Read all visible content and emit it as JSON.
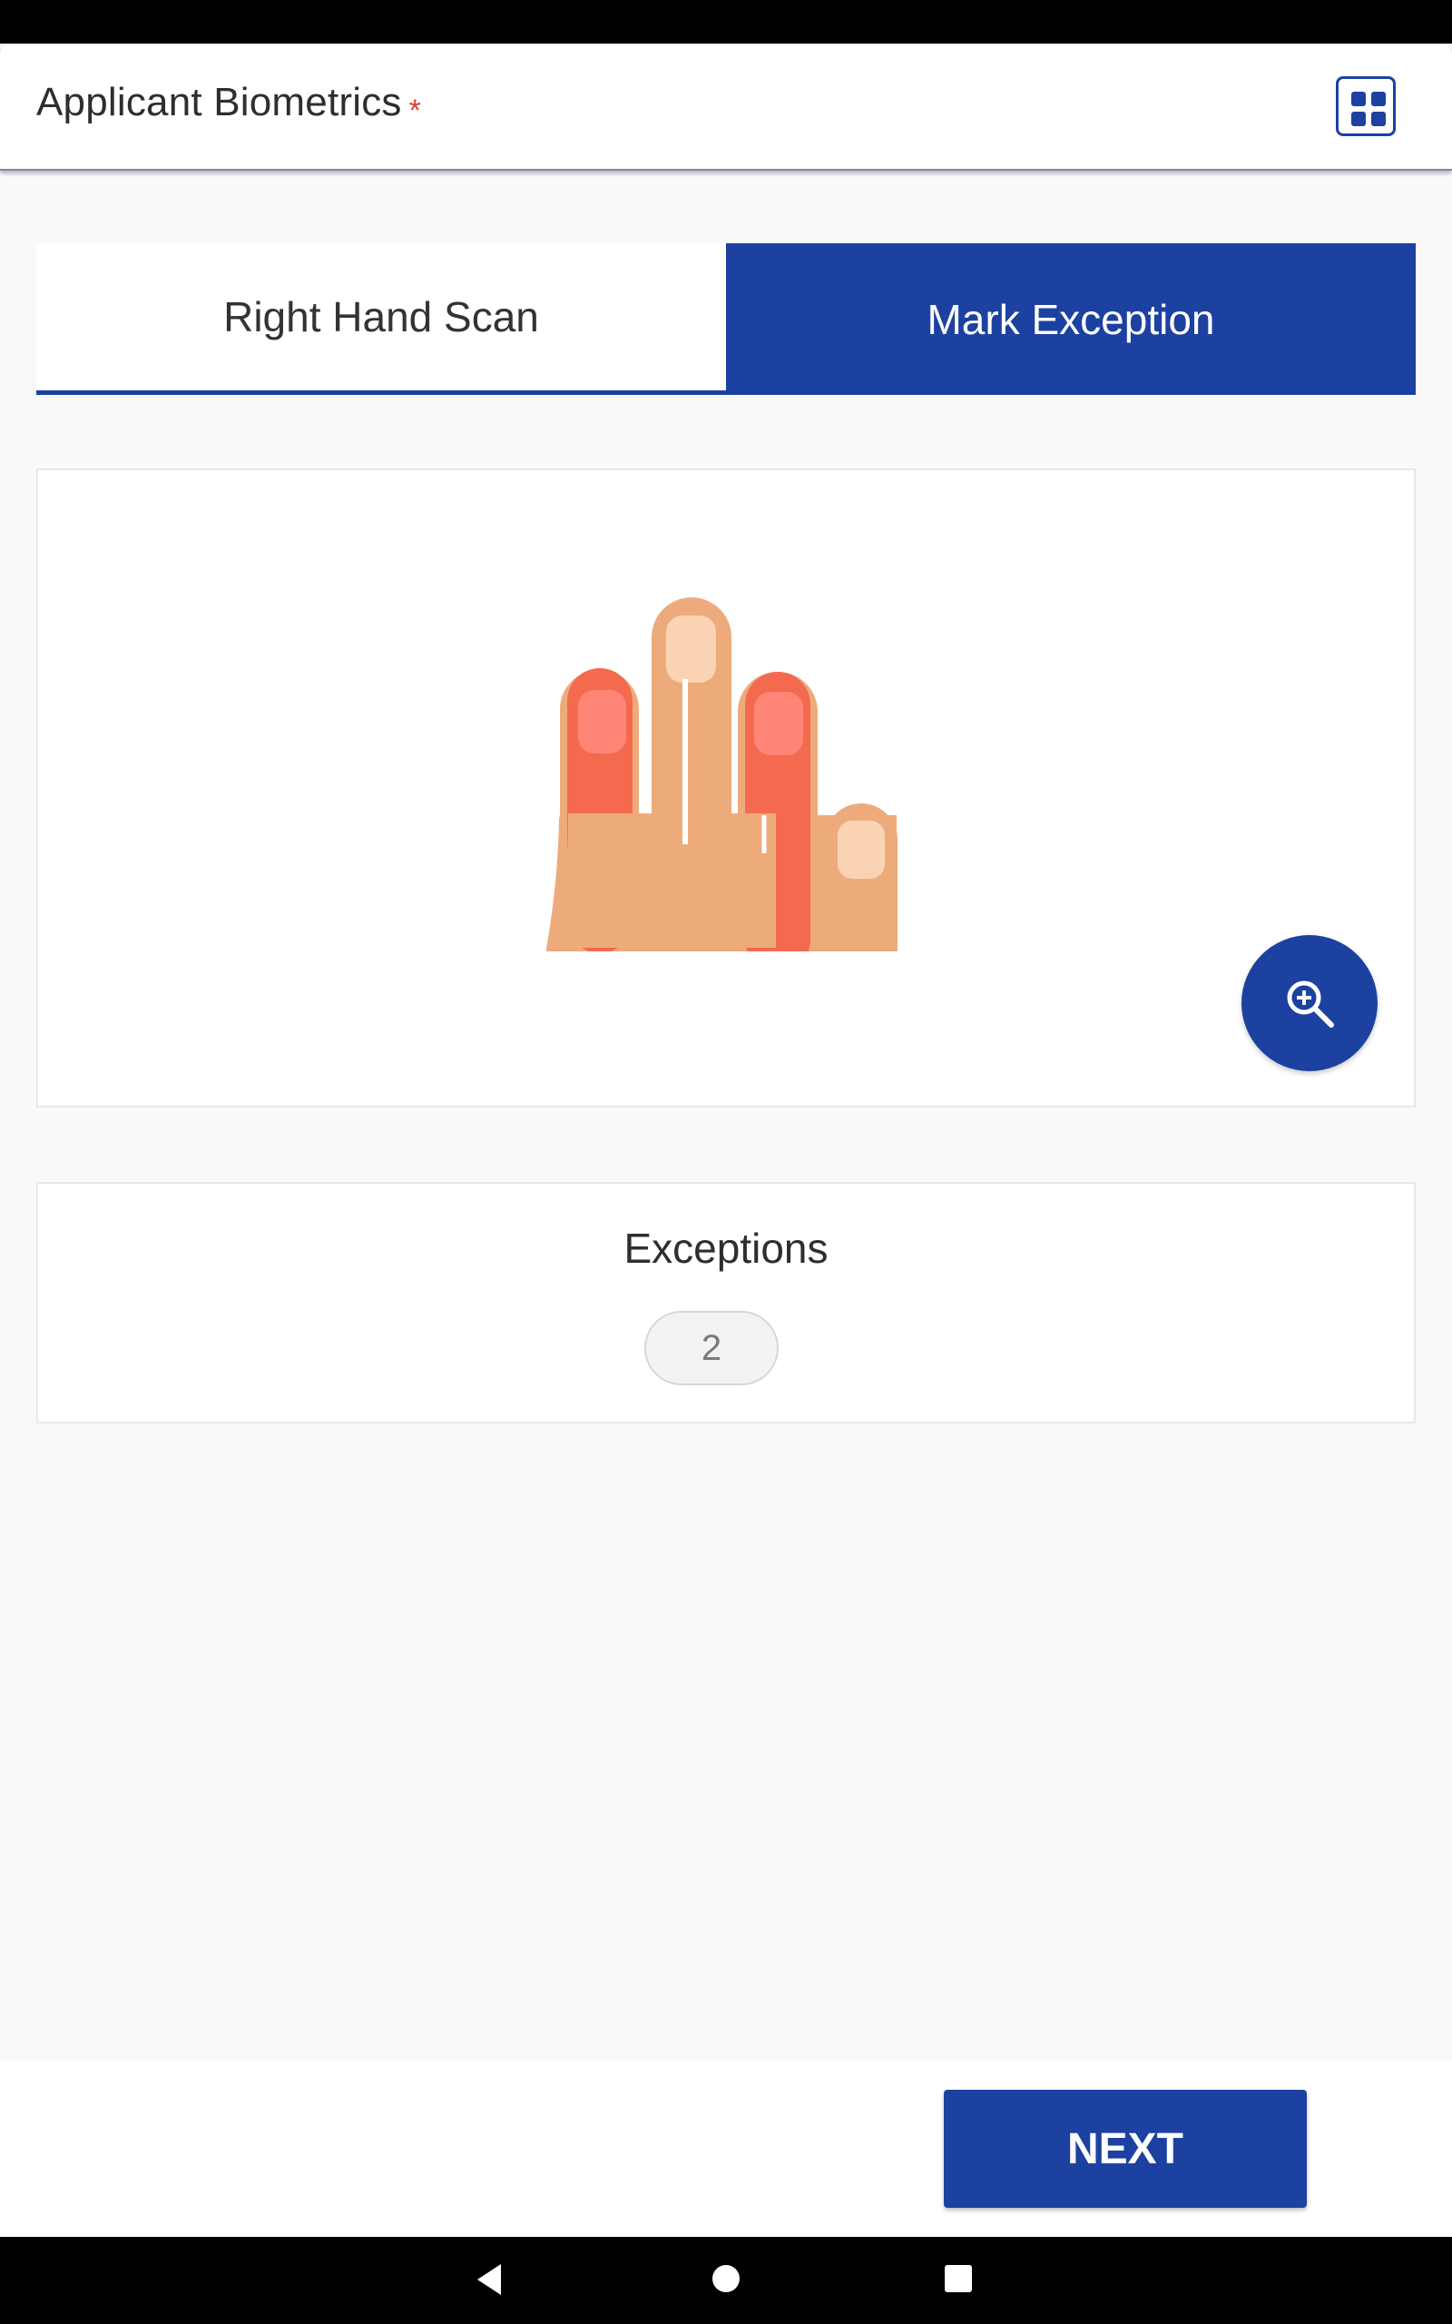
{
  "app_bar": {
    "title": "Applicant Biometrics",
    "required_marker": "*",
    "menu_icon": "grid-apps-icon"
  },
  "tabs": [
    {
      "label": "Right Hand Scan",
      "selected": false
    },
    {
      "label": "Mark Exception",
      "selected": true
    }
  ],
  "hand_panel": {
    "fingers": [
      {
        "name": "index",
        "exception": true
      },
      {
        "name": "middle",
        "exception": false
      },
      {
        "name": "ring",
        "exception": true
      },
      {
        "name": "little",
        "exception": false
      }
    ],
    "zoom_icon": "zoom-in-icon"
  },
  "exceptions": {
    "title": "Exceptions",
    "count": "2"
  },
  "footer": {
    "next_label": "NEXT"
  },
  "system_nav": {
    "back_icon": "back-triangle-icon",
    "home_icon": "home-circle-icon",
    "recents_icon": "recents-square-icon"
  },
  "colors": {
    "primary": "#1c41a0",
    "skin": "#edab7c",
    "exception_finger": "#f46a4f",
    "required": "#e53935"
  }
}
